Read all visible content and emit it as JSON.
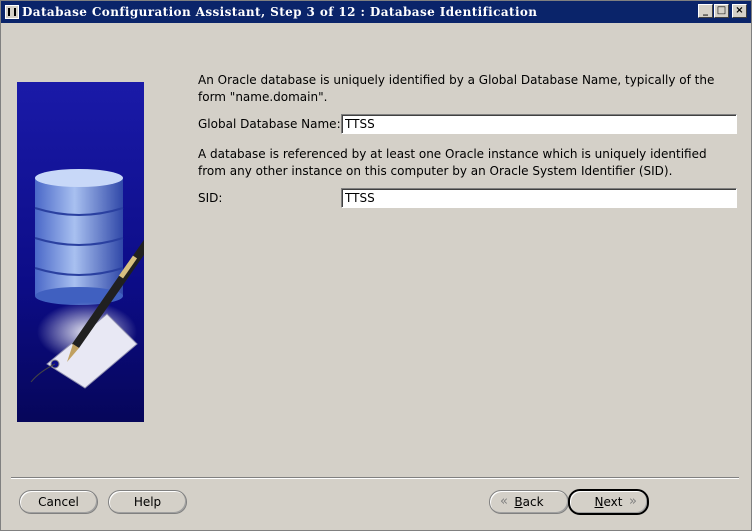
{
  "window": {
    "title": "Database Configuration Assistant, Step 3 of 12 : Database Identification",
    "minimize_glyph": "_",
    "maximize_glyph": "□",
    "close_glyph": "×"
  },
  "content": {
    "description_1": "An Oracle database is uniquely identified by a Global Database Name, typically of the form \"name.domain\".",
    "global_db_name_label": "Global Database Name:",
    "global_db_name_value": "TTSS",
    "description_2": "A database is referenced by at least one Oracle instance which is uniquely identified from any other instance on this computer by an Oracle System Identifier (SID).",
    "sid_label": "SID:",
    "sid_value": "TTSS"
  },
  "buttons": {
    "cancel": "Cancel",
    "help": "Help",
    "back_prefix": "",
    "back_mnemonic": "B",
    "back_rest": "ack",
    "next_mnemonic": "N",
    "next_rest": "ext",
    "back_chevron": "«",
    "next_chevron": "»"
  },
  "icons": {
    "banner": "database-pen-illustration",
    "app": "window-app-icon"
  },
  "colors": {
    "titlebar": "#0a246a",
    "banner": "#0c0c86",
    "dialog": "#d4d0c8"
  }
}
